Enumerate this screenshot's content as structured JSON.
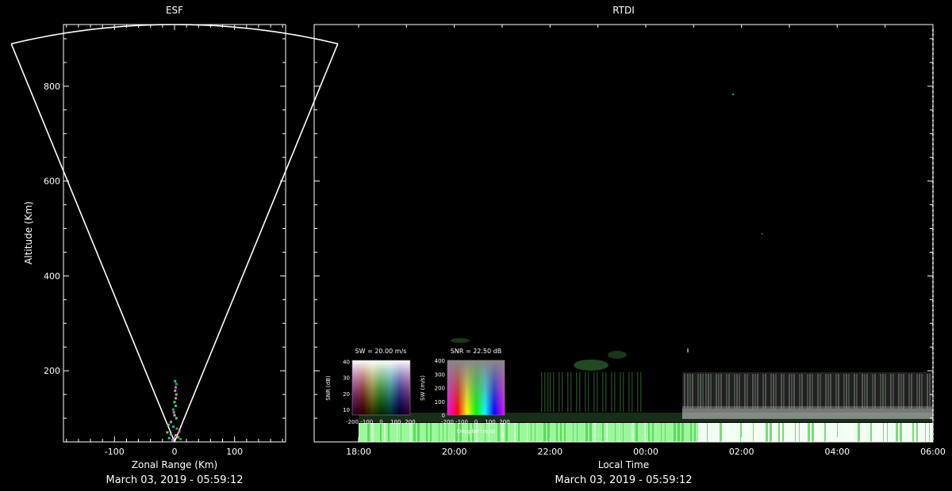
{
  "chart_data": [
    {
      "type": "scatter",
      "title": "ESF",
      "xlabel": "Zonal Range (Km)",
      "ylabel": "Altitude (Km)",
      "xlim": [
        -185,
        185
      ],
      "ylim": [
        50,
        930
      ],
      "x_ticks": [
        -100,
        0,
        100
      ],
      "y_ticks": [
        200,
        400,
        600,
        800
      ],
      "timestamp": "March 03, 2019 - 05:59:12",
      "beam": {
        "half_angle_deg": 17,
        "outer_range_km": 930
      },
      "echo_points": [
        {
          "x": 1,
          "y": 178
        },
        {
          "x": 3,
          "y": 172
        },
        {
          "x": 2,
          "y": 165
        },
        {
          "x": 1,
          "y": 158
        },
        {
          "x": 3,
          "y": 150
        },
        {
          "x": 2,
          "y": 142
        },
        {
          "x": 0,
          "y": 134
        },
        {
          "x": 2,
          "y": 126
        },
        {
          "x": -2,
          "y": 118
        },
        {
          "x": -1,
          "y": 112
        },
        {
          "x": 0,
          "y": 106
        },
        {
          "x": 3,
          "y": 100
        },
        {
          "x": -6,
          "y": 92
        },
        {
          "x": -10,
          "y": 86
        },
        {
          "x": -2,
          "y": 82
        },
        {
          "x": 4,
          "y": 78
        },
        {
          "x": 8,
          "y": 72
        },
        {
          "x": -12,
          "y": 70
        },
        {
          "x": -6,
          "y": 66
        },
        {
          "x": 2,
          "y": 64
        },
        {
          "x": 6,
          "y": 60
        },
        {
          "x": -9,
          "y": 58
        },
        {
          "x": 10,
          "y": 56
        },
        {
          "x": -3,
          "y": 54
        }
      ]
    },
    {
      "type": "heatmap",
      "title": "RTDI",
      "xlabel": "Local Time",
      "ylabel": "",
      "x_ticks": [
        "18:00",
        "20:00",
        "22:00",
        "00:00",
        "02:00",
        "04:00",
        "06:00"
      ],
      "timestamp": "March 03, 2019 - 05:59:12",
      "legends": [
        {
          "title": "SW = 20.00 m/s",
          "xlabel": "",
          "ylabel": "SNR (dB)",
          "x_ticks": [
            "-200",
            "-100",
            "0",
            "100",
            "200"
          ],
          "y_ticks": [
            "10",
            "20",
            "30",
            "40"
          ]
        },
        {
          "title": "SNR = 22.50 dB",
          "xlabel": "Doppler (m/s)",
          "ylabel": "SW (m/s)",
          "x_ticks": [
            "-200",
            "-100",
            "0",
            "100",
            "200"
          ],
          "y_ticks": [
            "0",
            "100",
            "200",
            "300",
            "400"
          ]
        }
      ]
    }
  ]
}
